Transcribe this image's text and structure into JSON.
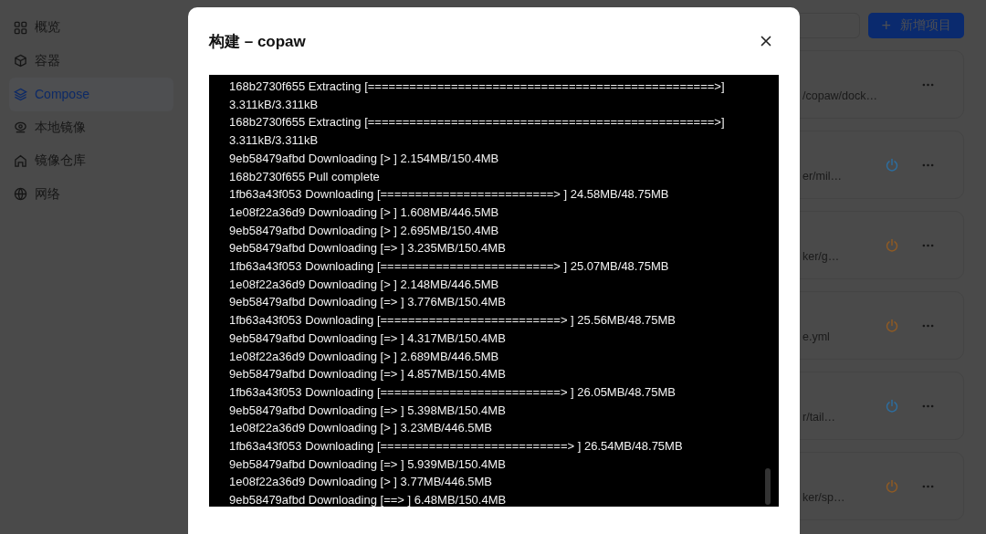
{
  "sidebar": {
    "items": [
      {
        "label": "概览",
        "selected": false
      },
      {
        "label": "容器",
        "selected": false
      },
      {
        "label": "Compose",
        "selected": true
      },
      {
        "label": "本地镜像",
        "selected": false
      },
      {
        "label": "镜像仓库",
        "selected": false
      },
      {
        "label": "网络",
        "selected": false
      }
    ]
  },
  "toolbar": {
    "new_button": {
      "icon": "+",
      "label": "新增项目"
    }
  },
  "projects": [
    {
      "path": "/copaw/dock…"
    },
    {
      "path": "er/mil…",
      "color": "#2d6d9e"
    },
    {
      "path": "ker/g…",
      "color": "#8e5a24"
    },
    {
      "path": "e.yml",
      "color": "#8e5a24"
    },
    {
      "path": "r/tail…",
      "color": "#2d6d9e"
    },
    {
      "path": "ker/sp…",
      "color": "#8e5a24"
    }
  ],
  "dialog": {
    "title": "构建 – copaw",
    "log": [
      "168b2730f655 Extracting [==================================================>] 3.311kB/3.311kB",
      "168b2730f655 Extracting [==================================================>] 3.311kB/3.311kB",
      "9eb58479afbd Downloading [> ] 2.154MB/150.4MB",
      "168b2730f655 Pull complete",
      "1fb63a43f053 Downloading [=========================> ] 24.58MB/48.75MB",
      "1e08f22a36d9 Downloading [> ] 1.608MB/446.5MB",
      "9eb58479afbd Downloading [> ] 2.695MB/150.4MB",
      "9eb58479afbd Downloading [=> ] 3.235MB/150.4MB",
      "1fb63a43f053 Downloading [=========================> ] 25.07MB/48.75MB",
      "1e08f22a36d9 Downloading [> ] 2.148MB/446.5MB",
      "9eb58479afbd Downloading [=> ] 3.776MB/150.4MB",
      "1fb63a43f053 Downloading [==========================> ] 25.56MB/48.75MB",
      "9eb58479afbd Downloading [=> ] 4.317MB/150.4MB",
      "1e08f22a36d9 Downloading [> ] 2.689MB/446.5MB",
      "9eb58479afbd Downloading [=> ] 4.857MB/150.4MB",
      "1fb63a43f053 Downloading [==========================> ] 26.05MB/48.75MB",
      "9eb58479afbd Downloading [=> ] 5.398MB/150.4MB",
      "1e08f22a36d9 Downloading [> ] 3.23MB/446.5MB",
      "1fb63a43f053 Downloading [===========================> ] 26.54MB/48.75MB",
      "9eb58479afbd Downloading [=> ] 5.939MB/150.4MB",
      "1e08f22a36d9 Downloading [> ] 3.77MB/446.5MB",
      "9eb58479afbd Downloading [==> ] 6.48MB/150.4MB"
    ]
  }
}
